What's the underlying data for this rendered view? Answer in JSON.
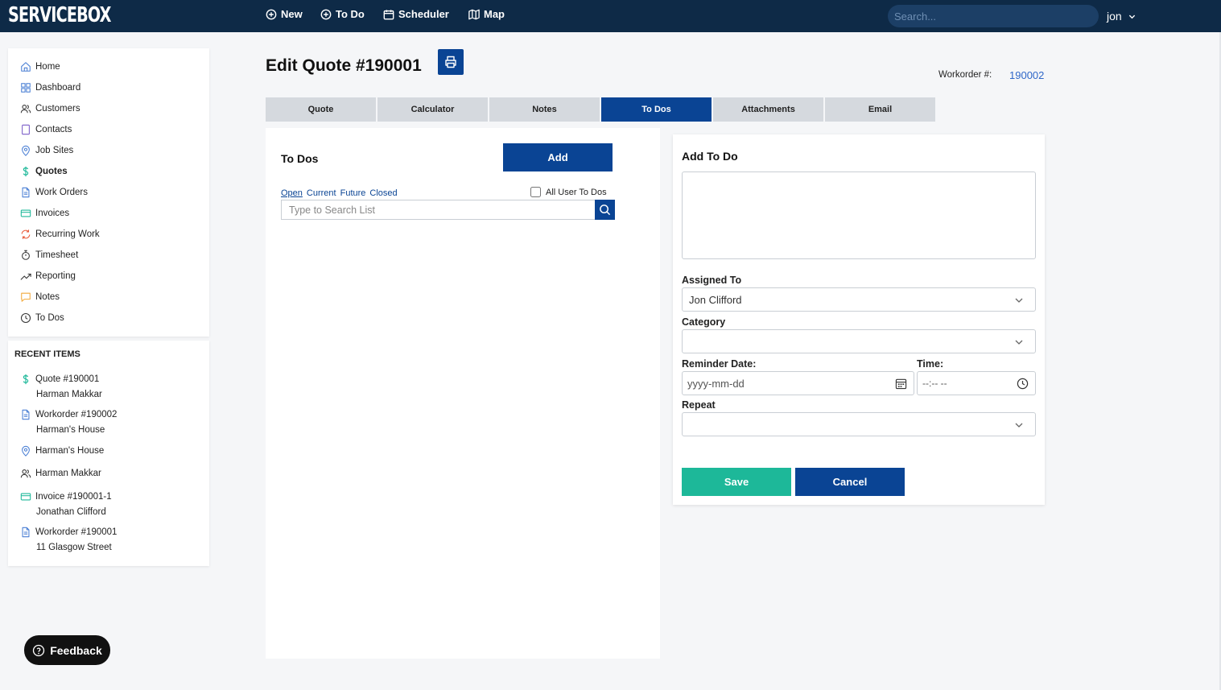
{
  "app": {
    "logo": "SERVICEBOX",
    "user": "jon"
  },
  "topnav": [
    {
      "label": "New",
      "icon": "plus-circle-icon"
    },
    {
      "label": "To Do",
      "icon": "plus-circle-icon"
    },
    {
      "label": "Scheduler",
      "icon": "calendar-icon"
    },
    {
      "label": "Map",
      "icon": "map-icon"
    }
  ],
  "search": {
    "placeholder": "Search..."
  },
  "sidebar": {
    "items": [
      {
        "label": "Home",
        "icon": "home-icon"
      },
      {
        "label": "Dashboard",
        "icon": "dashboard-icon"
      },
      {
        "label": "Customers",
        "icon": "users-icon"
      },
      {
        "label": "Contacts",
        "icon": "contact-icon"
      },
      {
        "label": "Job Sites",
        "icon": "location-pin-icon"
      },
      {
        "label": "Quotes",
        "icon": "dollar-icon"
      },
      {
        "label": "Work Orders",
        "icon": "document-icon"
      },
      {
        "label": "Invoices",
        "icon": "credit-card-icon"
      },
      {
        "label": "Recurring Work",
        "icon": "refresh-icon"
      },
      {
        "label": "Timesheet",
        "icon": "stopwatch-icon"
      },
      {
        "label": "Reporting",
        "icon": "trend-icon"
      },
      {
        "label": "Notes",
        "icon": "chat-icon"
      },
      {
        "label": "To Dos",
        "icon": "clock-icon"
      }
    ],
    "active": "Quotes"
  },
  "recent": {
    "title": "RECENT ITEMS",
    "items": [
      {
        "line1": "Quote #190001",
        "line2": "Harman Makkar",
        "icon": "dollar-icon"
      },
      {
        "line1": "Workorder #190002",
        "line2": "Harman's House",
        "icon": "document-icon"
      },
      {
        "line1": "Harman's House",
        "line2": "",
        "icon": "location-pin-icon"
      },
      {
        "line1": "Harman Makkar",
        "line2": "",
        "icon": "users-icon"
      },
      {
        "line1": "Invoice #190001-1",
        "line2": "Jonathan Clifford",
        "icon": "credit-card-icon"
      },
      {
        "line1": "Workorder #190001",
        "line2": "11 Glasgow Street",
        "icon": "document-icon"
      }
    ]
  },
  "feedback": {
    "label": "Feedback"
  },
  "page": {
    "title": "Edit Quote #190001",
    "workorder_label": "Workorder #:",
    "workorder_value": "190002"
  },
  "tabs": [
    {
      "label": "Quote"
    },
    {
      "label": "Calculator"
    },
    {
      "label": "Notes"
    },
    {
      "label": "To Dos"
    },
    {
      "label": "Attachments"
    },
    {
      "label": "Email"
    }
  ],
  "active_tab": "To Dos",
  "todos": {
    "title": "To Dos",
    "add_label": "Add",
    "filters": [
      "Open",
      "Current",
      "Future",
      "Closed"
    ],
    "selected_filter": "Open",
    "all_user_label": "All User To Dos",
    "all_user_checked": false,
    "search_placeholder": "Type to Search List"
  },
  "form": {
    "title": "Add To Do",
    "assigned_label": "Assigned To",
    "assigned_value": "Jon Clifford",
    "category_label": "Category",
    "category_value": "",
    "reminder_label": "Reminder Date:",
    "reminder_placeholder": "yyyy-mm-dd",
    "time_label": "Time:",
    "time_placeholder": "--:-- --",
    "repeat_label": "Repeat",
    "repeat_value": "",
    "save_label": "Save",
    "cancel_label": "Cancel"
  },
  "colors": {
    "topbar": "#0e2a47",
    "primary": "#0a4494",
    "save": "#1db899",
    "link": "#2f67c8"
  }
}
